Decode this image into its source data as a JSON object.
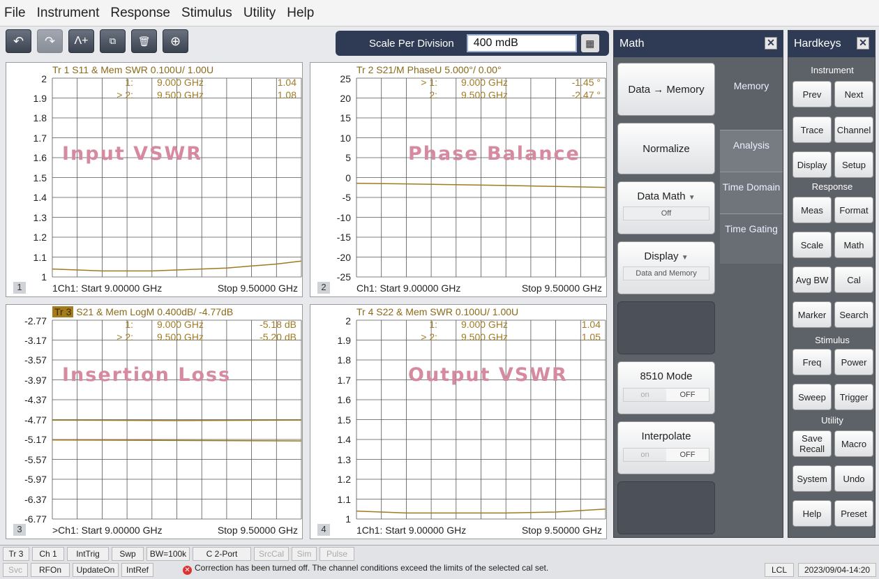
{
  "menu": [
    "File",
    "Instrument",
    "Response",
    "Stimulus",
    "Utility",
    "Help"
  ],
  "toolbar": {
    "icons": [
      "undo-icon",
      "redo-icon",
      "marker-add-icon",
      "copy-display-icon",
      "trash-icon",
      "zoom-icon"
    ],
    "scale_label": "Scale Per Division",
    "scale_value": "400 mdB"
  },
  "panels": [
    {
      "title": "Tr 1  S11 & Mem SWR 0.100U/  1.00U",
      "markers": [
        {
          "id": "1:",
          "freq": "9.000  GHz",
          "val": "1.04"
        },
        {
          "id": "> 2:",
          "freq": "9.500  GHz",
          "val": "1.08"
        }
      ],
      "yticks": [
        "2",
        "1.9",
        "1.8",
        "1.7",
        "1.6",
        "1.5",
        "1.4",
        "1.3",
        "1.2",
        "1.1",
        "1"
      ],
      "watermark": "Input VSWR",
      "start": "1Ch1:  Start  9.00000 GHz",
      "stop": "Stop  9.50000 GHz",
      "num": "1"
    },
    {
      "title": "Tr  2   S21/M PhaseU 5.000°/  0.00°",
      "markers": [
        {
          "id": "> 1:",
          "freq": "9.000  GHz",
          "val": "-1.45 °"
        },
        {
          "id": "2:",
          "freq": "9.500  GHz",
          "val": "-2.47 °"
        }
      ],
      "yticks": [
        "25",
        "20",
        "15",
        "10",
        "5",
        "0",
        "-5",
        "-10",
        "-15",
        "-20",
        "-25"
      ],
      "watermark": "Phase Balance",
      "start": "Ch1:  Start  9.00000 GHz",
      "stop": "Stop  9.50000 GHz",
      "num": "2"
    },
    {
      "title_hl": "Tr  3",
      "title": "  S21 & Mem LogM 0.400dB/  -4.77dB",
      "markers": [
        {
          "id": "1:",
          "freq": "9.000  GHz",
          "val": "-5.18 dB"
        },
        {
          "id": "> 2:",
          "freq": "9.500  GHz",
          "val": "-5.20 dB"
        }
      ],
      "yticks": [
        "-2.77",
        "-3.17",
        "-3.57",
        "-3.97",
        "-4.37",
        "-4.77",
        "-5.17",
        "-5.57",
        "-5.97",
        "-6.37",
        "-6.77"
      ],
      "watermark": "Insertion Loss",
      "start": ">Ch1:  Start  9.00000 GHz",
      "stop": "Stop  9.50000 GHz",
      "num": "3"
    },
    {
      "title": "Tr  4   S22 & Mem SWR 0.100U/  1.00U",
      "markers": [
        {
          "id": "1:",
          "freq": "9.000  GHz",
          "val": "1.04"
        },
        {
          "id": "> 2:",
          "freq": "9.500  GHz",
          "val": "1.05"
        }
      ],
      "yticks": [
        "2",
        "1.9",
        "1.8",
        "1.7",
        "1.6",
        "1.5",
        "1.4",
        "1.3",
        "1.2",
        "1.1",
        "1"
      ],
      "watermark": "Output VSWR",
      "start": "1Ch1:  Start  9.00000 GHz",
      "stop": "Stop  9.50000 GHz",
      "num": "4"
    }
  ],
  "chart_data": [
    {
      "type": "line",
      "title": "Tr 1  S11 & Mem SWR 0.100U/  1.00U",
      "x": [
        9.0,
        9.5
      ],
      "ylim": [
        1.0,
        2.0
      ],
      "series": [
        {
          "name": "Tr 1",
          "x": [
            9.0,
            9.05,
            9.1,
            9.15,
            9.2,
            9.25,
            9.3,
            9.35,
            9.4,
            9.45,
            9.5
          ],
          "values": [
            1.04,
            1.035,
            1.03,
            1.03,
            1.03,
            1.035,
            1.04,
            1.045,
            1.055,
            1.065,
            1.08
          ]
        }
      ]
    },
    {
      "type": "line",
      "title": "Tr  2   S21/M PhaseU 5.000°/  0.00°",
      "ylim": [
        -25,
        25
      ],
      "series": [
        {
          "name": "Tr 2",
          "x": [
            9.0,
            9.1,
            9.2,
            9.3,
            9.4,
            9.5
          ],
          "values": [
            -1.45,
            -1.6,
            -1.8,
            -2.0,
            -2.25,
            -2.47
          ]
        }
      ]
    },
    {
      "type": "line",
      "title": "Tr  3  S21 & Mem LogM 0.400dB/  -4.77dB",
      "ylim": [
        -6.77,
        -2.77
      ],
      "series": [
        {
          "name": "Data",
          "x": [
            9.0,
            9.25,
            9.5
          ],
          "values": [
            -5.18,
            -5.19,
            -5.2
          ]
        },
        {
          "name": "Memory",
          "x": [
            9.0,
            9.25,
            9.5
          ],
          "values": [
            -4.78,
            -4.79,
            -4.78
          ]
        }
      ]
    },
    {
      "type": "line",
      "title": "Tr  4   S22 & Mem SWR 0.100U/  1.00U",
      "ylim": [
        1.0,
        2.0
      ],
      "series": [
        {
          "name": "Tr 4",
          "x": [
            9.0,
            9.1,
            9.2,
            9.3,
            9.4,
            9.5
          ],
          "values": [
            1.04,
            1.03,
            1.03,
            1.03,
            1.035,
            1.05
          ]
        }
      ]
    }
  ],
  "math": {
    "title": "Math",
    "buttons": {
      "data_memory": "Data → Memory",
      "normalize": "Normalize",
      "data_math": "Data Math",
      "data_math_value": "Off",
      "display": "Display",
      "display_value": "Data and Memory",
      "mode8510": "8510 Mode",
      "interpolate": "Interpolate",
      "on": "on",
      "off": "OFF"
    },
    "tabs": [
      "Memory",
      "Analysis",
      "Time Domain",
      "Time Gating"
    ]
  },
  "hardkeys": {
    "title": "Hardkeys",
    "sections": [
      "Instrument",
      "Response",
      "Stimulus",
      "Utility"
    ],
    "keys": [
      [
        "Prev",
        "Next"
      ],
      [
        "Trace",
        "Channel"
      ],
      [
        "Display",
        "Setup"
      ],
      [
        "Meas",
        "Format"
      ],
      [
        "Scale",
        "Math"
      ],
      [
        "Avg BW",
        "Cal"
      ],
      [
        "Marker",
        "Search"
      ],
      [
        "Freq",
        "Power"
      ],
      [
        "Sweep",
        "Trigger"
      ],
      [
        "Save Recall",
        "Macro"
      ],
      [
        "System",
        "Undo"
      ],
      [
        "Help",
        "Preset"
      ]
    ]
  },
  "status": {
    "row1": [
      "Tr 3",
      "Ch 1",
      "IntTrig",
      "Swp",
      "BW=100k",
      "C  2-Port",
      "SrcCal",
      "Sim",
      "Pulse"
    ],
    "row2": [
      "Svc",
      "RFOn",
      "UpdateOn",
      "IntRef"
    ],
    "message": "Correction has been turned off. The channel conditions exceed the limits of the selected cal set.",
    "lcl": "LCL",
    "datetime": "2023/09/04-14:20"
  }
}
